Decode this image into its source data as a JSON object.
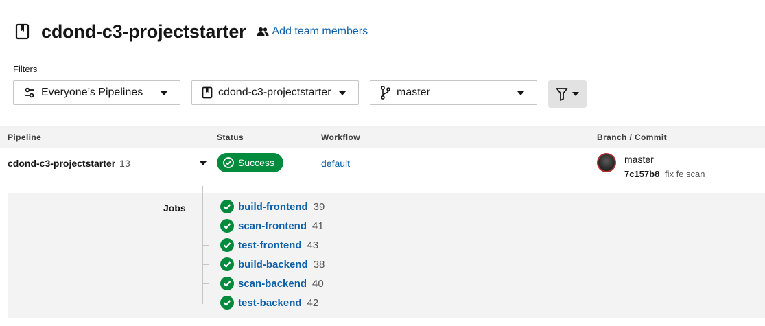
{
  "header": {
    "title": "cdond-c3-projectstarter",
    "add_team_label": "Add team members"
  },
  "filters": {
    "label": "Filters",
    "pipelines": "Everyone’s Pipelines",
    "project": "cdond-c3-projectstarter",
    "branch": "master"
  },
  "table": {
    "headers": [
      "Pipeline",
      "Status",
      "Workflow",
      "Branch / Commit"
    ]
  },
  "pipeline": {
    "name": "cdond-c3-projectstarter",
    "number": "13",
    "status": "Success",
    "workflow": "default",
    "branch": "master",
    "commit_hash": "7c157b8",
    "commit_msg": "fix fe scan"
  },
  "jobs": {
    "label": "Jobs",
    "items": [
      {
        "name": "build-frontend",
        "number": "39"
      },
      {
        "name": "scan-frontend",
        "number": "41"
      },
      {
        "name": "test-frontend",
        "number": "43"
      },
      {
        "name": "build-backend",
        "number": "38"
      },
      {
        "name": "scan-backend",
        "number": "40"
      },
      {
        "name": "test-backend",
        "number": "42"
      }
    ]
  },
  "colors": {
    "accent": "#0d5fa6",
    "success": "#028a3d"
  },
  "icons": [
    "project-icon",
    "people-icon",
    "settings-sliders-icon",
    "branch-icon",
    "funnel-icon",
    "check-circle-icon"
  ]
}
